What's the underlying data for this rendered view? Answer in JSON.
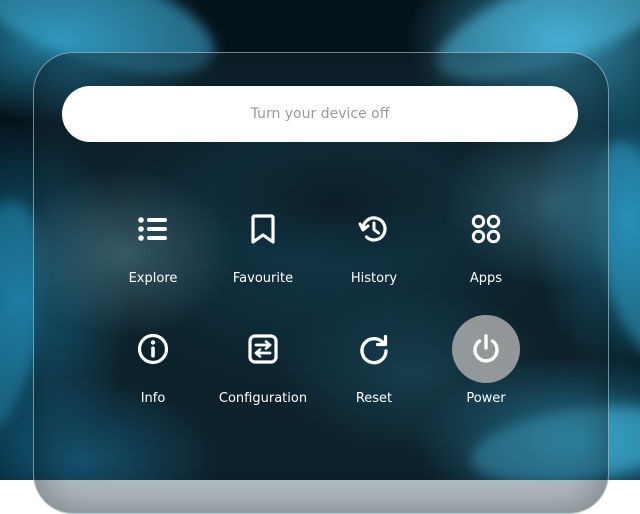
{
  "prompt": {
    "text": "Turn your device off"
  },
  "menu": {
    "items": [
      {
        "label": "Explore",
        "icon": "list-icon"
      },
      {
        "label": "Favourite",
        "icon": "bookmark-icon"
      },
      {
        "label": "History",
        "icon": "history-icon"
      },
      {
        "label": "Apps",
        "icon": "apps-icon"
      },
      {
        "label": "Info",
        "icon": "info-icon"
      },
      {
        "label": "Configuration",
        "icon": "configuration-icon"
      },
      {
        "label": "Reset",
        "icon": "reset-icon"
      },
      {
        "label": "Power",
        "icon": "power-icon",
        "selected": true
      }
    ]
  },
  "colors": {
    "prompt_text": "#9a9a9a",
    "label": "#ffffff",
    "selected_bg": "#aaaaaa",
    "wallpaper_accent": "#1e8cb4"
  }
}
